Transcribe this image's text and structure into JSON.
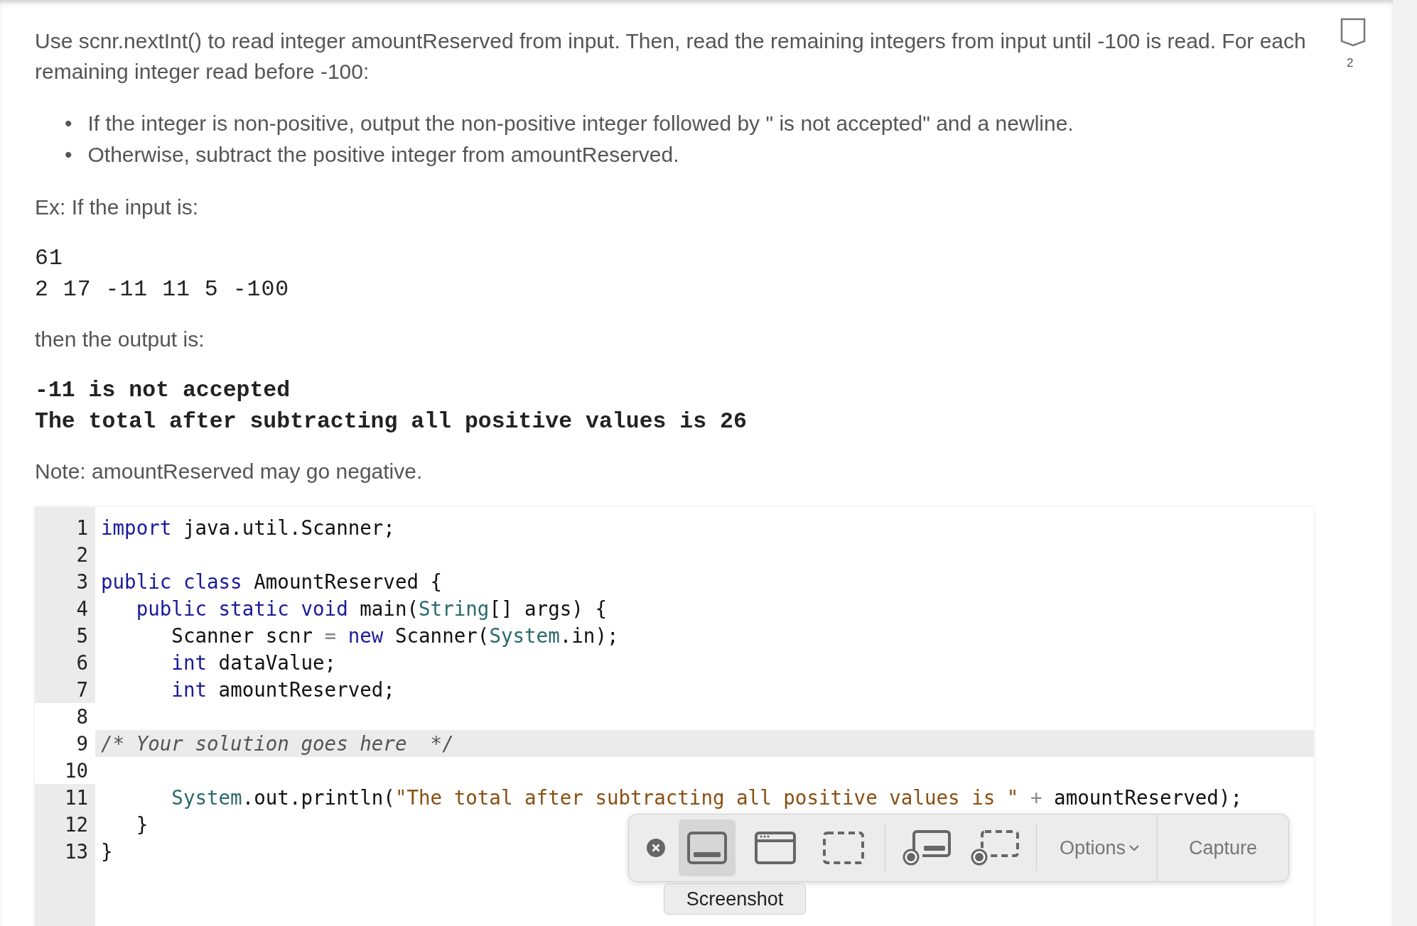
{
  "intro": "Use scnr.nextInt() to read integer amountReserved from input. Then, read the remaining integers from input until -100 is read. For each remaining integer read before -100:",
  "bullets": [
    {
      "marker": "•",
      "text": "If the integer is non-positive, output the non-positive integer followed by \" is not accepted\" and a newline."
    },
    {
      "marker": "•",
      "text": "Otherwise, subtract the positive integer from amountReserved."
    }
  ],
  "example_label": "Ex: If the input is:",
  "example_input": [
    "61",
    "2 17 -11 11 5 -100"
  ],
  "output_label": "then the output is:",
  "example_output": [
    "-11 is not accepted",
    "The total after subtracting all positive values is 26"
  ],
  "note": "Note: amountReserved may go negative.",
  "bookmark": {
    "count": "2"
  },
  "code": {
    "lines": [
      {
        "number": "1",
        "editable": false,
        "active": false,
        "tokens": [
          {
            "kind": "keyword",
            "text": "import"
          },
          {
            "kind": "plain",
            "text": " java.util.Scanner;"
          }
        ]
      },
      {
        "number": "2",
        "editable": false,
        "active": false
      },
      {
        "number": "3",
        "editable": false,
        "active": false,
        "tokens": [
          {
            "kind": "keyword",
            "text": "public class"
          },
          {
            "kind": "plain",
            "text": " AmountReserved {"
          }
        ]
      },
      {
        "number": "4",
        "editable": false,
        "active": false,
        "tokens": [
          {
            "kind": "keyword",
            "text": "   public static void"
          },
          {
            "kind": "plain",
            "text": " main("
          },
          {
            "kind": "type",
            "text": "String"
          },
          {
            "kind": "plain",
            "text": "[] args) {"
          }
        ]
      },
      {
        "number": "5",
        "editable": false,
        "active": false,
        "tokens": [
          {
            "kind": "plain",
            "text": "      Scanner scnr "
          },
          {
            "kind": "operator",
            "text": "="
          },
          {
            "kind": "keyword",
            "text": " new"
          },
          {
            "kind": "plain",
            "text": " Scanner("
          },
          {
            "kind": "type",
            "text": "System"
          },
          {
            "kind": "plain",
            "text": ".in);"
          }
        ]
      },
      {
        "number": "6",
        "editable": false,
        "active": false,
        "tokens": [
          {
            "kind": "keyword",
            "text": "      int"
          },
          {
            "kind": "plain",
            "text": " dataValue;"
          }
        ]
      },
      {
        "number": "7",
        "editable": false,
        "active": false,
        "tokens": [
          {
            "kind": "keyword",
            "text": "      int"
          },
          {
            "kind": "plain",
            "text": " amountReserved;"
          }
        ]
      },
      {
        "number": "8",
        "editable": true,
        "active": false
      },
      {
        "number": "9",
        "editable": true,
        "active": true,
        "tokens": [
          {
            "kind": "comment",
            "text": "/* Your solution goes here  */"
          }
        ]
      },
      {
        "number": "10",
        "editable": true,
        "active": false
      },
      {
        "number": "11",
        "editable": false,
        "active": false,
        "tokens": [
          {
            "kind": "type",
            "text": "      System"
          },
          {
            "kind": "plain",
            "text": ".out.println("
          },
          {
            "kind": "string",
            "text": "\"The total after subtracting all positive values is \""
          },
          {
            "kind": "operator",
            "text": " +"
          },
          {
            "kind": "plain",
            "text": " amountReserved);"
          }
        ]
      },
      {
        "number": "12",
        "editable": false,
        "active": false,
        "tokens": [
          {
            "kind": "plain",
            "text": "   }"
          }
        ]
      },
      {
        "number": "13",
        "editable": false,
        "active": false,
        "tokens": [
          {
            "kind": "plain",
            "text": "}"
          }
        ]
      }
    ]
  },
  "capture_toolbar": {
    "tools": [
      {
        "kind": "close",
        "selected": false
      },
      {
        "kind": "screen",
        "selected": true
      },
      {
        "kind": "window",
        "selected": false
      },
      {
        "kind": "selection",
        "selected": false
      },
      {
        "kind": "record-screen",
        "selected": false
      },
      {
        "kind": "record-selection",
        "selected": false
      }
    ],
    "options": "Options",
    "capture": "Capture",
    "tooltip": "Screenshot"
  }
}
